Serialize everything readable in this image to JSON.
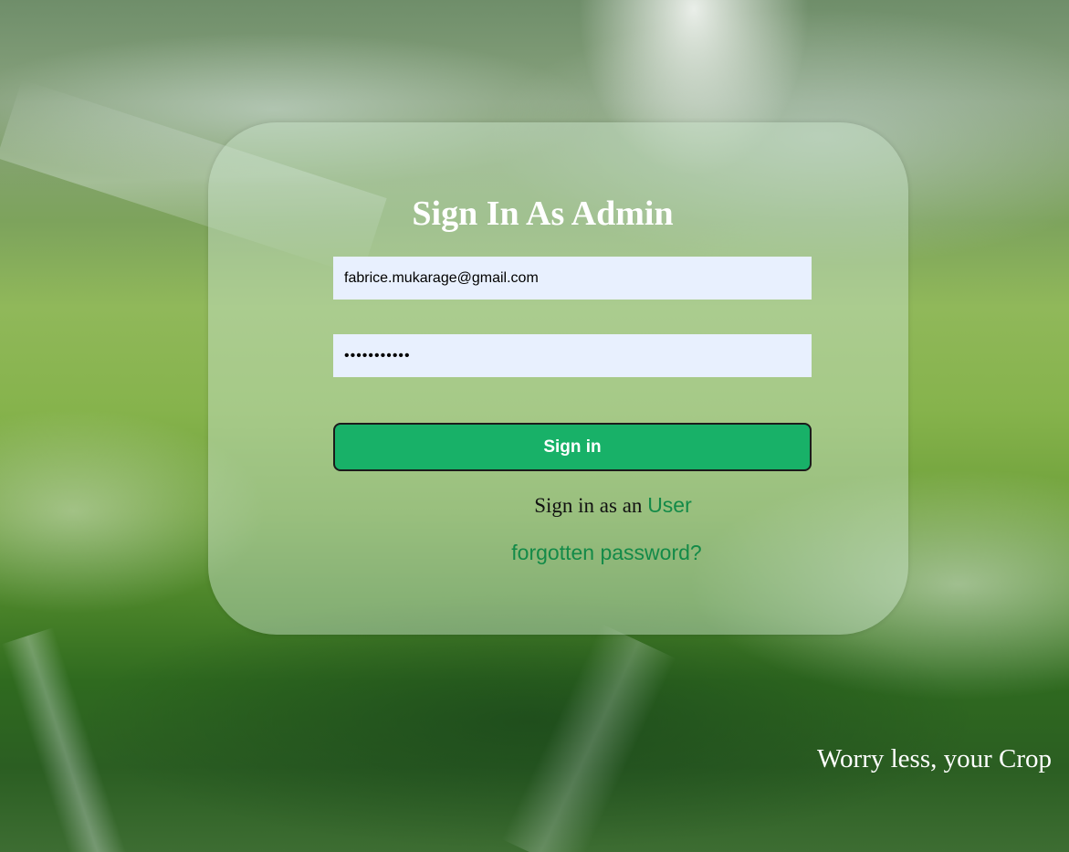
{
  "login": {
    "title": "Sign In As Admin",
    "email_value": "fabrice.mukarage@gmail.com",
    "password_value": "•••••••••••",
    "signin_label": "Sign in",
    "alt_text": "Sign in as an",
    "alt_link": "User",
    "forgot_link": "forgotten password?"
  },
  "footer": {
    "tagline": "Worry less, your Crop"
  },
  "colors": {
    "accent": "#18b168",
    "link": "#138a48",
    "input_bg": "#e8f0fe"
  }
}
